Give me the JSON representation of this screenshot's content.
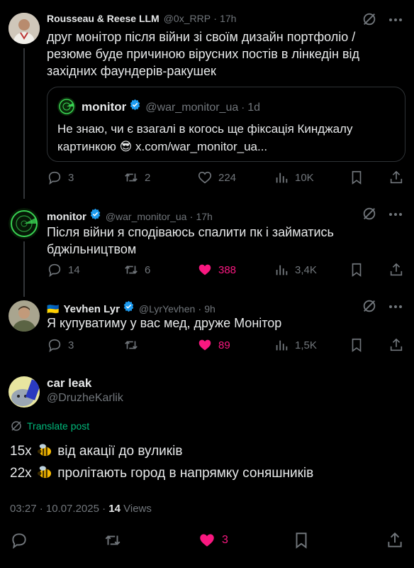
{
  "tweets": [
    {
      "name": "Rousseau & Reese LLM",
      "handle": "@0x_RRP",
      "time": "17h",
      "text": "друг монітор після війни зі своїм дизайн портфоліо / резюме буде причиною вірусних постів в лінкедін від західних фаундерів-ракушек",
      "quote": {
        "name": "monitor",
        "handle": "@war_monitor_ua",
        "time": "1d",
        "text": "Не знаю, чи є взагалі в когось ще фіксація Кинджалу картинкою 😎 x.com/war_monitor_ua..."
      },
      "stats": {
        "replies": "3",
        "reposts": "2",
        "likes": "224",
        "views": "10K"
      }
    },
    {
      "name": "monitor",
      "handle": "@war_monitor_ua",
      "time": "17h",
      "text": "Після війни я сподіваюсь спалити пк і займатись бджільництвом",
      "stats": {
        "replies": "14",
        "reposts": "6",
        "likes": "388",
        "views": "3,4K"
      }
    },
    {
      "name": "Yevhen Lyr",
      "flag": "🇺🇦",
      "handle": "@LyrYevhen",
      "time": "9h",
      "text": "Я купуватиму у вас мед, друже Монітор",
      "stats": {
        "replies": "3",
        "reposts": "",
        "likes": "89",
        "views": "1,5K"
      }
    }
  ],
  "main": {
    "name": "car leak",
    "handle": "@DruzheKarlik",
    "translate": "Translate post",
    "line1_count": "15x",
    "line1_text": "від акації до вуликів",
    "line2_count": "22x",
    "line2_text": "пролітають город в напрямку соняшників",
    "timestamp": "03:27 · 10.07.2025 · ",
    "views_count": "14",
    "views_label": "Views",
    "likes": "3"
  },
  "colors": {
    "accent": "#1d9bf0",
    "like": "#f91880",
    "muted": "#71767b",
    "translate": "#00ba7c"
  },
  "icons": [
    "reply-icon",
    "repost-icon",
    "like-icon",
    "views-icon",
    "bookmark-icon",
    "share-icon",
    "grok-icon",
    "more-icon",
    "verified-icon",
    "translate-icon"
  ]
}
